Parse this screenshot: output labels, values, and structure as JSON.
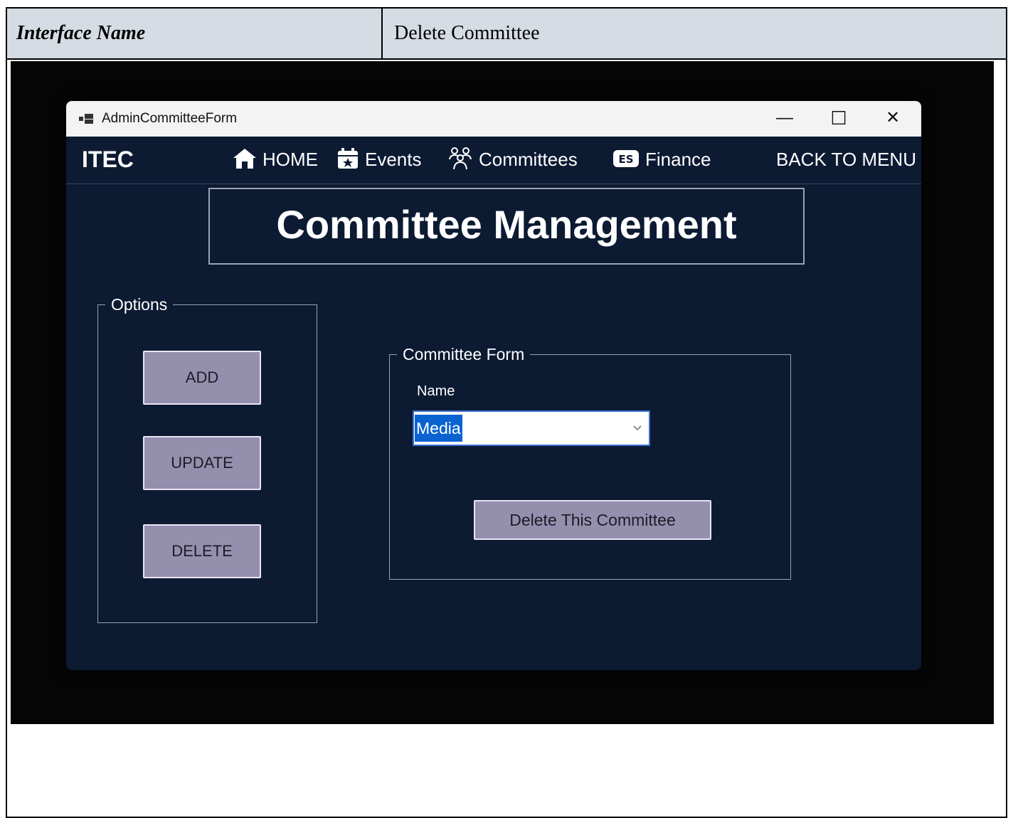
{
  "document": {
    "label": "Interface Name",
    "value": "Delete Committee"
  },
  "window": {
    "title": "AdminCommitteeForm",
    "controls": {
      "minimize": "—",
      "maximize": "☐",
      "close": "✕"
    }
  },
  "navbar": {
    "brand": "ITEC",
    "items": [
      {
        "label": "HOME",
        "icon": "home-icon"
      },
      {
        "label": "Events",
        "icon": "calendar-star-icon"
      },
      {
        "label": "Committees",
        "icon": "group-icon"
      },
      {
        "label": "Finance",
        "icon": "money-icon"
      }
    ],
    "back": "BACK TO MENU"
  },
  "page": {
    "title": "Committee Management"
  },
  "options": {
    "legend": "Options",
    "buttons": [
      "ADD",
      "UPDATE",
      "DELETE"
    ]
  },
  "form": {
    "legend": "Committee Form",
    "name_label": "Name",
    "name_value": "Media",
    "submit": "Delete This Committee"
  },
  "colors": {
    "window_bg": "#0c1a32",
    "button_bg": "#958fae",
    "selection": "#0a63d1",
    "header_bg": "#d6dce4"
  }
}
